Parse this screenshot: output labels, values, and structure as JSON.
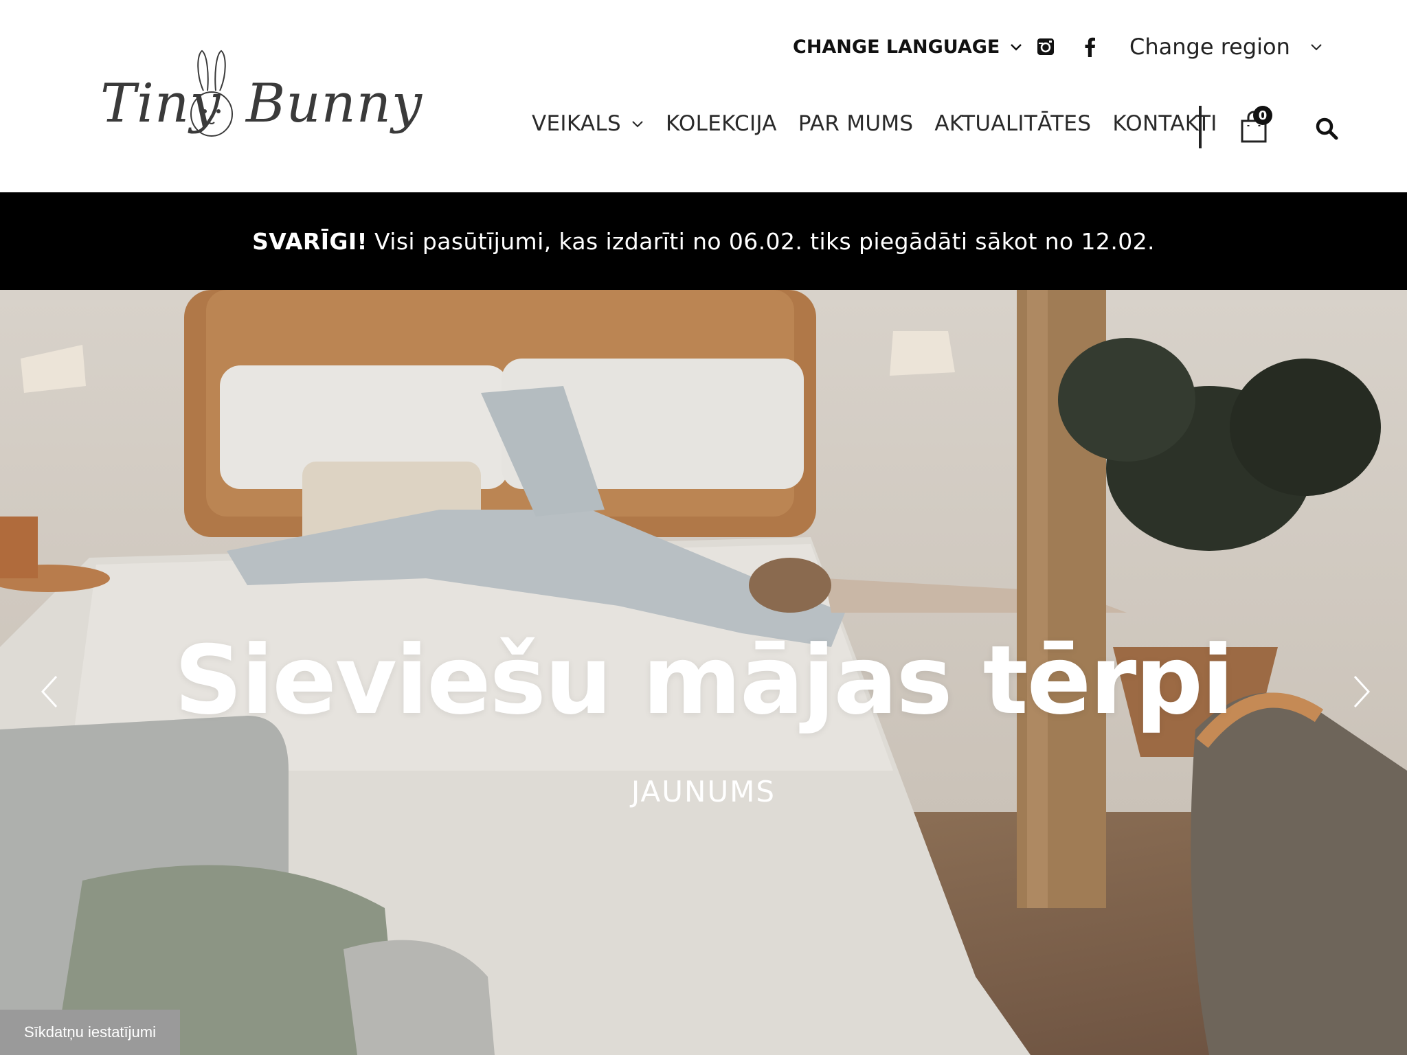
{
  "brand": {
    "name_left": "Tiny",
    "name_right": "Bunny"
  },
  "header": {
    "change_language": "CHANGE LANGUAGE",
    "change_region": "Change region",
    "social": [
      "instagram-icon",
      "facebook-icon"
    ],
    "nav": [
      {
        "label": "VEIKALS",
        "has_dropdown": true
      },
      {
        "label": "KOLEKCIJA"
      },
      {
        "label": "PAR MUMS"
      },
      {
        "label": "AKTUALITĀTES"
      },
      {
        "label": "KONTAKTI"
      }
    ],
    "cart_count": "0"
  },
  "notice": {
    "strong": "SVARĪGI!",
    "text": "Visi pasūtījumi, kas izdarīti no 06.02. tiks piegādāti sākot no 12.02."
  },
  "hero": {
    "title": "Sieviešu mājas tērpi",
    "subtitle": "JAUNUMS"
  },
  "cookie_button": "Sīkdatņu iestatījumi",
  "colors": {
    "notice_bg": "#000000",
    "text_dark": "#1a1a1a",
    "cookie_bg": "#9a9a9a"
  }
}
